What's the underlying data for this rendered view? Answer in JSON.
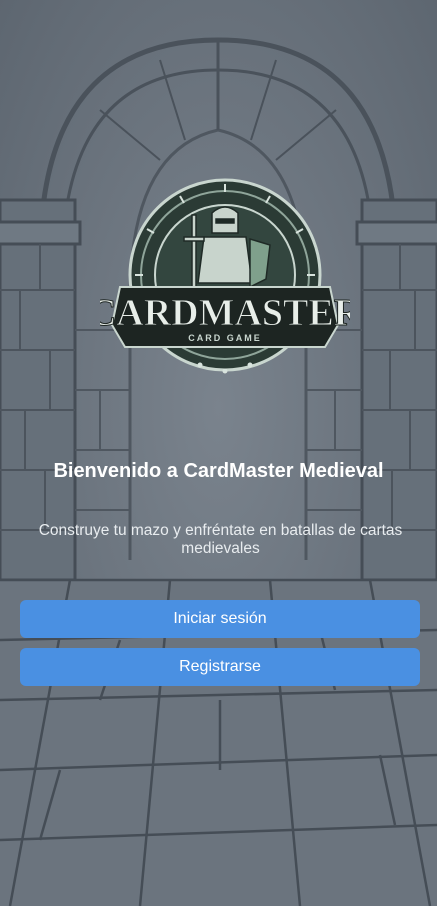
{
  "logo": {
    "title": "CARDMASTER",
    "tagline": "CARD GAME"
  },
  "welcome": {
    "title": "Bienvenido a CardMaster Medieval",
    "subtitle": "Construye tu mazo y enfréntate en batallas de cartas medievales"
  },
  "actions": {
    "login_label": "Iniciar sesión",
    "register_label": "Registrarse"
  },
  "colors": {
    "button": "#4a90e2",
    "background": "#6d7782"
  }
}
